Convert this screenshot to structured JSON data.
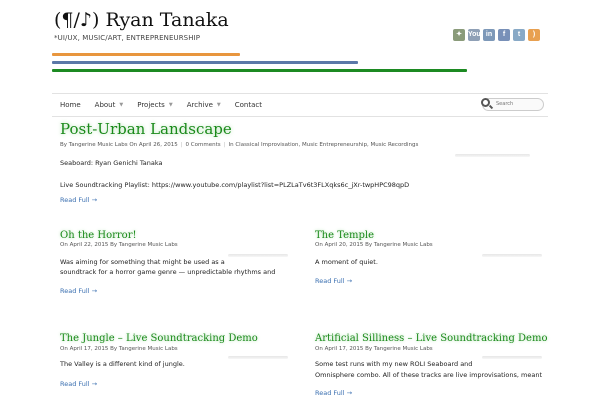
{
  "site": {
    "title": "(¶/♪) Ryan Tanaka",
    "tagline": "*UI/UX, MUSIC/ART, ENTREPRENEURSHIP"
  },
  "social_icons": [
    {
      "name": "rss-feed-icon",
      "glyph": "✦",
      "color": "#8a9b7a"
    },
    {
      "name": "youtube-icon",
      "glyph": "You",
      "color": "#8fa0b6"
    },
    {
      "name": "linkedin-icon",
      "glyph": "in",
      "color": "#7d98b8"
    },
    {
      "name": "facebook-icon",
      "glyph": "f",
      "color": "#7890b8"
    },
    {
      "name": "twitter-icon",
      "glyph": "t",
      "color": "#88a9c6"
    },
    {
      "name": "rss-icon",
      "glyph": ")",
      "color": "#e8a050"
    }
  ],
  "nav": {
    "items": [
      {
        "label": "Home",
        "caret": false
      },
      {
        "label": "About",
        "caret": true
      },
      {
        "label": "Projects",
        "caret": true
      },
      {
        "label": "Archive",
        "caret": true
      },
      {
        "label": "Contact",
        "caret": false
      }
    ],
    "search_placeholder": "Search"
  },
  "featured": {
    "title": "Post-Urban Landscape",
    "meta_by": "By",
    "author": "Tangerine Music Labs",
    "date_prefix": "On April 26, 2015",
    "comments": "0 Comments",
    "categories": "In Classical Improvisation, Music Entrepreneurship, Music Recordings",
    "line1": "Seaboard: Ryan Genichi Tanaka",
    "line2": "Live Soundtracking Playlist: https://www.youtube.com/playlist?list=PLZLaTv6t3FLXqks6c_jXr-twpHPC98qpD",
    "read_more": "Read Full →"
  },
  "posts": [
    {
      "title": "Oh the Horror!",
      "meta": "On April 22, 2015 By Tangerine Music Labs",
      "line1": "Was aiming for something that might be used as a",
      "line2": "soundtrack for a horror game genre — unpredictable rhythms and",
      "read_more": "Read Full →"
    },
    {
      "title": "The Temple",
      "meta": "On April 20, 2015 By Tangerine Music Labs",
      "line1": "A moment of quiet.",
      "line2": "",
      "read_more": "Read Full →"
    },
    {
      "title": "The Jungle – Live Soundtracking Demo",
      "meta": "On April 17, 2015 By Tangerine Music Labs",
      "line1": "The Valley is a different kind of jungle.",
      "line2": "",
      "read_more": "Read Full →"
    },
    {
      "title": "Artificial Silliness – Live Soundtracking Demo",
      "meta": "On April 17, 2015 By Tangerine Music Labs",
      "line1": "Some test runs with my new ROLI Seaboard and",
      "line2": "Omnisphere combo. All of these tracks are live improvisations, meant",
      "read_more": "Read Full →"
    }
  ]
}
